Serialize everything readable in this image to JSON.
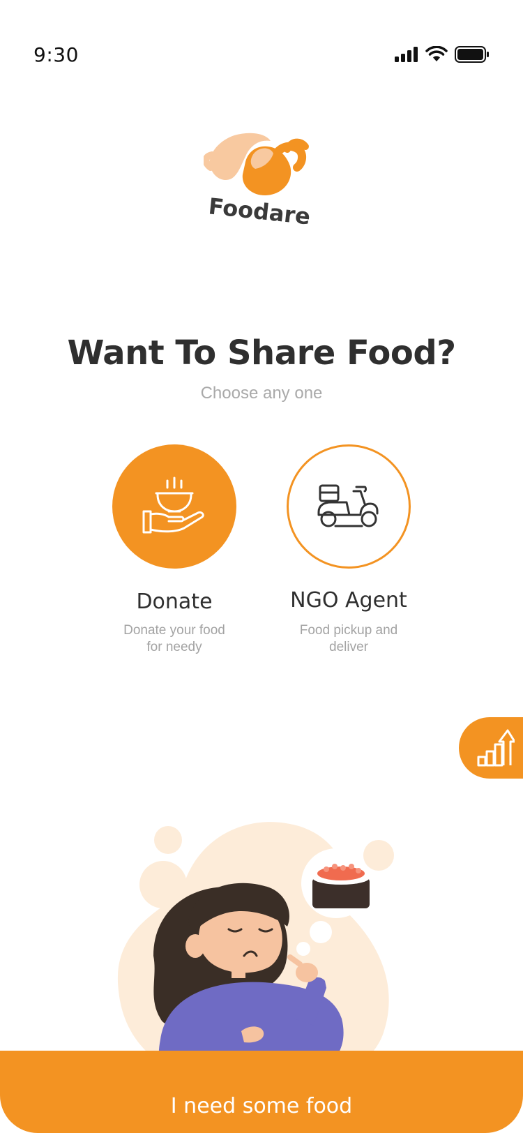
{
  "status": {
    "time": "9:30",
    "icons": [
      "cellular-signal-icon",
      "wifi-icon",
      "battery-icon"
    ]
  },
  "logo": {
    "text": "Foodare",
    "icon": "hands-logo-icon"
  },
  "heading": {
    "title": "Want To Share Food?",
    "subtitle": "Choose any one"
  },
  "options": [
    {
      "label": "Donate",
      "description_line1": "Donate your food",
      "description_line2": "for needy",
      "icon": "food-bowl-hand-icon",
      "selected": true
    },
    {
      "label": "NGO Agent",
      "description_line1": "Food pickup and",
      "description_line2": "deliver",
      "icon": "delivery-scooter-icon",
      "selected": false
    }
  ],
  "floating_button": {
    "icon": "bar-chart-growth-icon"
  },
  "illustration": {
    "icon": "girl-thinking-sushi-illustration"
  },
  "bottom_action": {
    "label": "I need some food"
  },
  "colors": {
    "accent": "#f39322",
    "title": "#2f2f2f",
    "muted": "#a9a9a9",
    "blob": "#fdecd9"
  }
}
